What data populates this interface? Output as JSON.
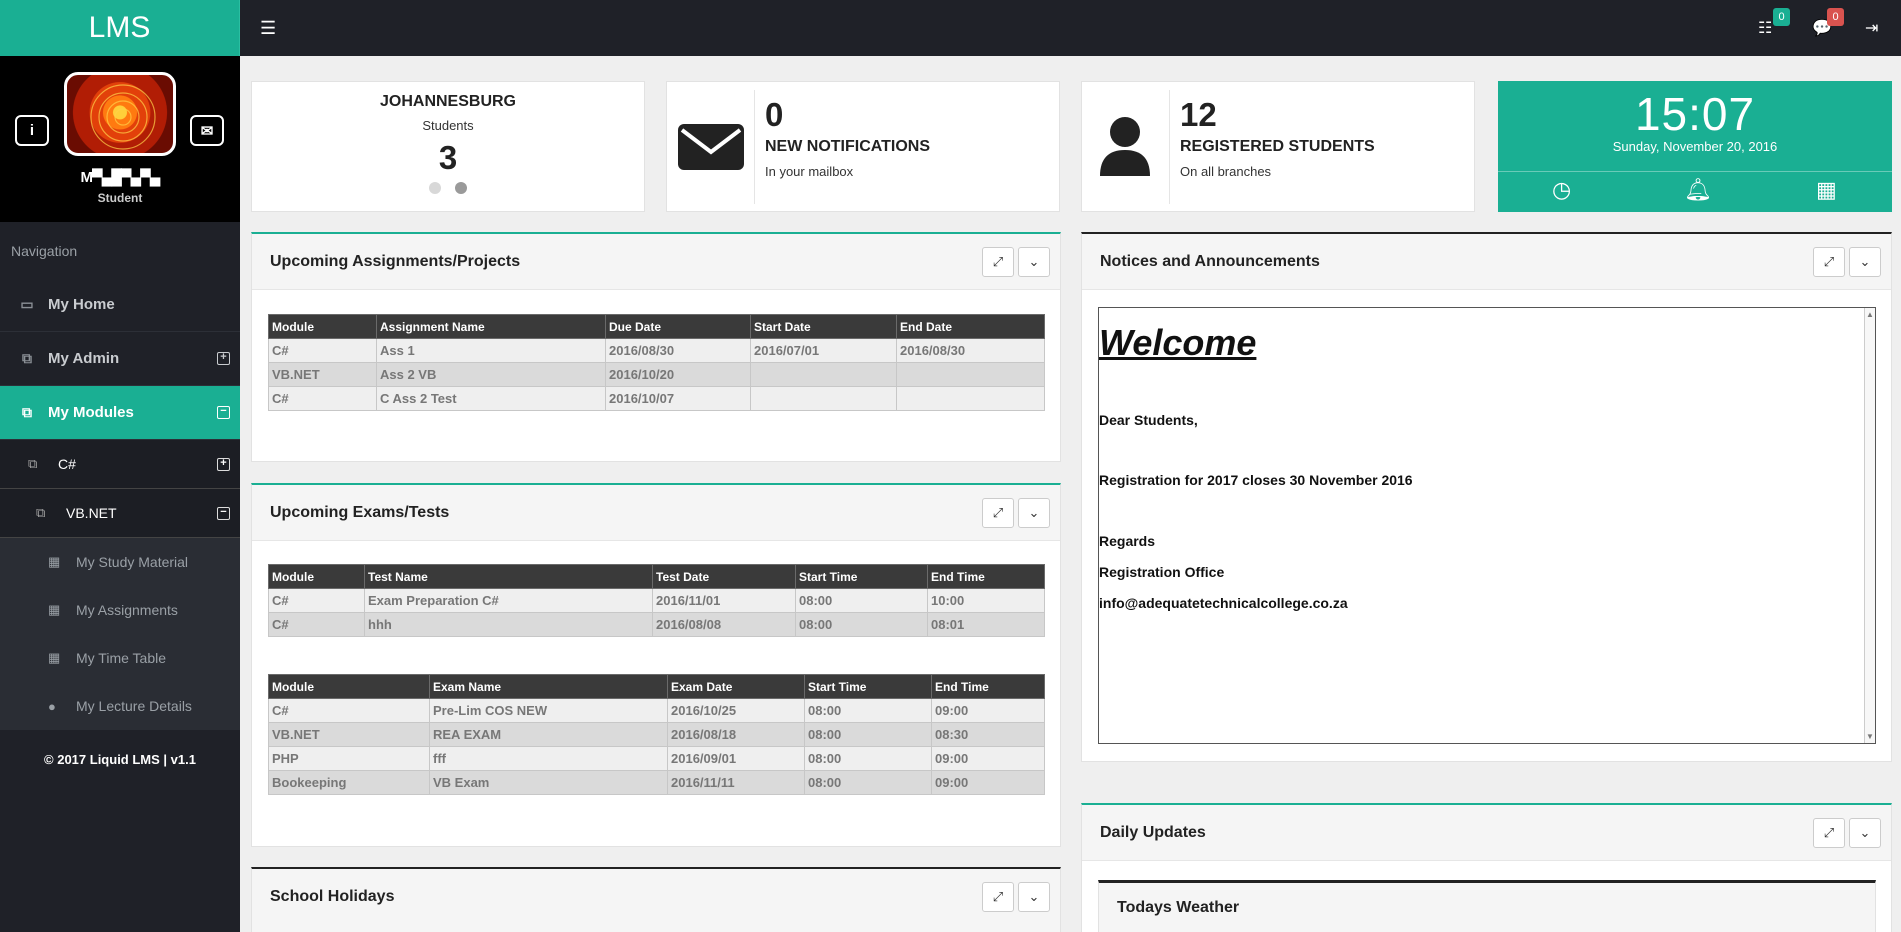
{
  "app": {
    "brand": "LMS"
  },
  "profile": {
    "name": "M▀▄█▀▄▀▄",
    "role": "Student",
    "info_btn": "i",
    "mail_btn": "✉"
  },
  "nav": {
    "heading": "Navigation",
    "items": [
      {
        "label": "My Home",
        "icon": "desktop-icon"
      },
      {
        "label": "My Admin",
        "icon": "copy-icon",
        "toggle": "+"
      },
      {
        "label": "My Modules",
        "icon": "copy-icon",
        "toggle": "−"
      }
    ],
    "modules": [
      {
        "label": "C#",
        "toggle": "+"
      },
      {
        "label": "VB.NET",
        "toggle": "−"
      }
    ],
    "leaves": [
      {
        "label": "My Study Material",
        "icon": "calendar-icon"
      },
      {
        "label": "My Assignments",
        "icon": "calendar-icon"
      },
      {
        "label": "My Time Table",
        "icon": "calendar-icon"
      },
      {
        "label": "My Lecture Details",
        "icon": "user-icon"
      }
    ],
    "copyright": "© 2017 Liquid LMS | v1.1"
  },
  "topbar": {
    "tasks_count": "0",
    "messages_count": "0",
    "badge_green": "#1aaf93",
    "badge_red": "#d9534f"
  },
  "stats": {
    "branch": {
      "city": "JOHANNESBURG",
      "label": "Students",
      "value": "3"
    },
    "notifications": {
      "value": "0",
      "title": "NEW NOTIFICATIONS",
      "sub": "In your mailbox"
    },
    "students": {
      "value": "12",
      "title": "REGISTERED STUDENTS",
      "sub": "On all branches"
    },
    "clock": {
      "time": "15:07",
      "date": "Sunday, November 20, 2016"
    }
  },
  "assignments": {
    "title": "Upcoming Assignments/Projects",
    "headers": [
      "Module",
      "Assignment Name",
      "Due Date",
      "Start Date",
      "End Date"
    ],
    "rows": [
      [
        "C#",
        "Ass 1",
        "2016/08/30",
        "2016/07/01",
        "2016/08/30"
      ],
      [
        "VB.NET",
        "Ass 2 VB",
        "2016/10/20",
        "",
        ""
      ],
      [
        "C#",
        "C Ass 2 Test",
        "2016/10/07",
        "",
        ""
      ]
    ]
  },
  "exams": {
    "title": "Upcoming Exams/Tests",
    "tests_headers": [
      "Module",
      "Test Name",
      "Test Date",
      "Start Time",
      "End Time"
    ],
    "tests_rows": [
      [
        "C#",
        "Exam Preparation C#",
        "2016/11/01",
        "08:00",
        "10:00"
      ],
      [
        "C#",
        "hhh",
        "2016/08/08",
        "08:00",
        "08:01"
      ]
    ],
    "exams_headers": [
      "Module",
      "Exam Name",
      "Exam Date",
      "Start Time",
      "End Time"
    ],
    "exams_rows": [
      [
        "C#",
        "Pre-Lim COS NEW",
        "2016/10/25",
        "08:00",
        "09:00"
      ],
      [
        "VB.NET",
        "REA EXAM",
        "2016/08/18",
        "08:00",
        "08:30"
      ],
      [
        "PHP",
        "fff",
        "2016/09/01",
        "08:00",
        "09:00"
      ],
      [
        "Bookeeping",
        "VB Exam",
        "2016/11/11",
        "08:00",
        "09:00"
      ]
    ]
  },
  "holidays": {
    "title": "School Holidays"
  },
  "notices": {
    "title": "Notices and Announcements",
    "welcome": "Welcome",
    "lines": [
      "Dear Students,",
      "Registration for 2017 closes 30 November 2016",
      "Regards",
      "Registration Office",
      "info@adequatetechnicalcollege.co.za"
    ]
  },
  "daily": {
    "title": "Daily Updates",
    "weather_title": "Todays Weather"
  },
  "colors": {
    "accent": "#1aaf93",
    "sidebar": "#1f2128"
  }
}
